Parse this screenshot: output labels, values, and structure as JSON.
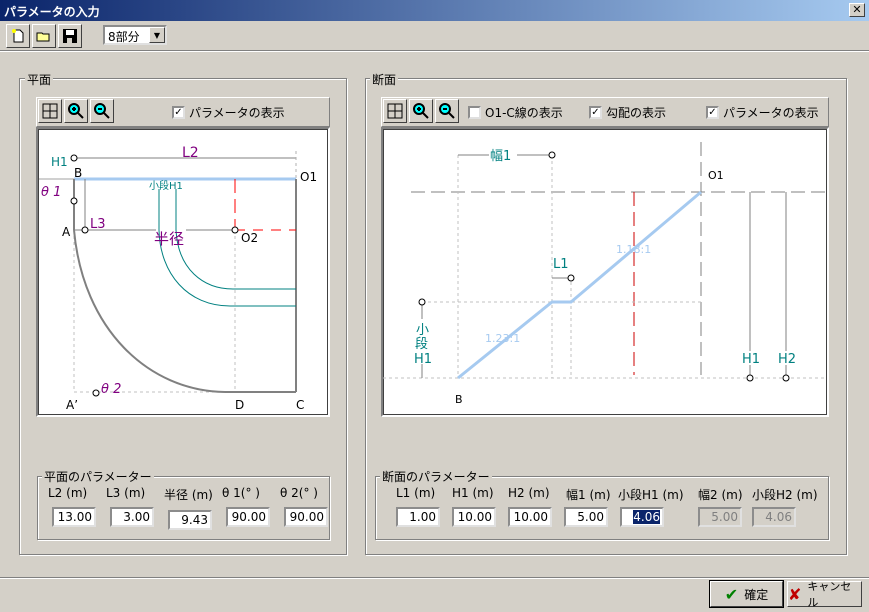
{
  "window": {
    "title": "パラメータの入力",
    "close": "✕"
  },
  "toolbar": {
    "new": "new-file",
    "open": "open-folder",
    "save": "save-disk",
    "combo_value": "8部分",
    "combo_arrow": "▼"
  },
  "plan": {
    "group_label": "平面",
    "show_params_label": "パラメータの表示",
    "show_params_checked": true,
    "labels": {
      "H1": "H1",
      "L2": "L2",
      "B": "B",
      "O1": "O1",
      "theta1": "θ 1",
      "A": "A",
      "L3": "L3",
      "kodan": "小段H1",
      "radius": "半径",
      "O2": "O2",
      "theta2": "θ 2",
      "Aprime": "A’",
      "D": "D",
      "C": "C"
    },
    "params_label": "平面のパラメーター",
    "params": [
      {
        "label": "L2 (m)",
        "value": "13.00"
      },
      {
        "label": "L3 (m)",
        "value": "3.00"
      },
      {
        "label": "半径 (m)",
        "value": "9.43"
      },
      {
        "label": "θ 1(° )",
        "value": "90.00"
      },
      {
        "label": "θ 2(° )",
        "value": "90.00"
      }
    ]
  },
  "section": {
    "group_label": "断面",
    "o1c_label": "O1-C線の表示",
    "o1c_checked": false,
    "slope_label": "勾配の表示",
    "slope_checked": true,
    "show_params_label": "パラメータの表示",
    "show_params_checked": true,
    "labels": {
      "haba1": "幅1",
      "O1": "O1",
      "L1": "L1",
      "slope_upper": "1.18:1",
      "slope_lower": "1.23:1",
      "ko": "小",
      "dan": "段",
      "kH1": "H1",
      "H1": "H1",
      "H2": "H2",
      "B": "B"
    },
    "params_label": "断面のパラメーター",
    "params": [
      {
        "label": "L1 (m)",
        "value": "1.00"
      },
      {
        "label": "H1 (m)",
        "value": "10.00"
      },
      {
        "label": "H2 (m)",
        "value": "10.00"
      },
      {
        "label": "幅1 (m)",
        "value": "5.00"
      },
      {
        "label": "小段H1 (m)",
        "value": "4.06"
      },
      {
        "label": "幅2 (m)",
        "value": "5.00"
      },
      {
        "label": "小段H2 (m)",
        "value": "4.06"
      }
    ]
  },
  "footer": {
    "ok": "確定",
    "cancel": "キャンセル"
  },
  "colors": {
    "purple": "#800080",
    "teal": "#008080",
    "slope": "#a6caf0",
    "red": "#ff0000"
  }
}
